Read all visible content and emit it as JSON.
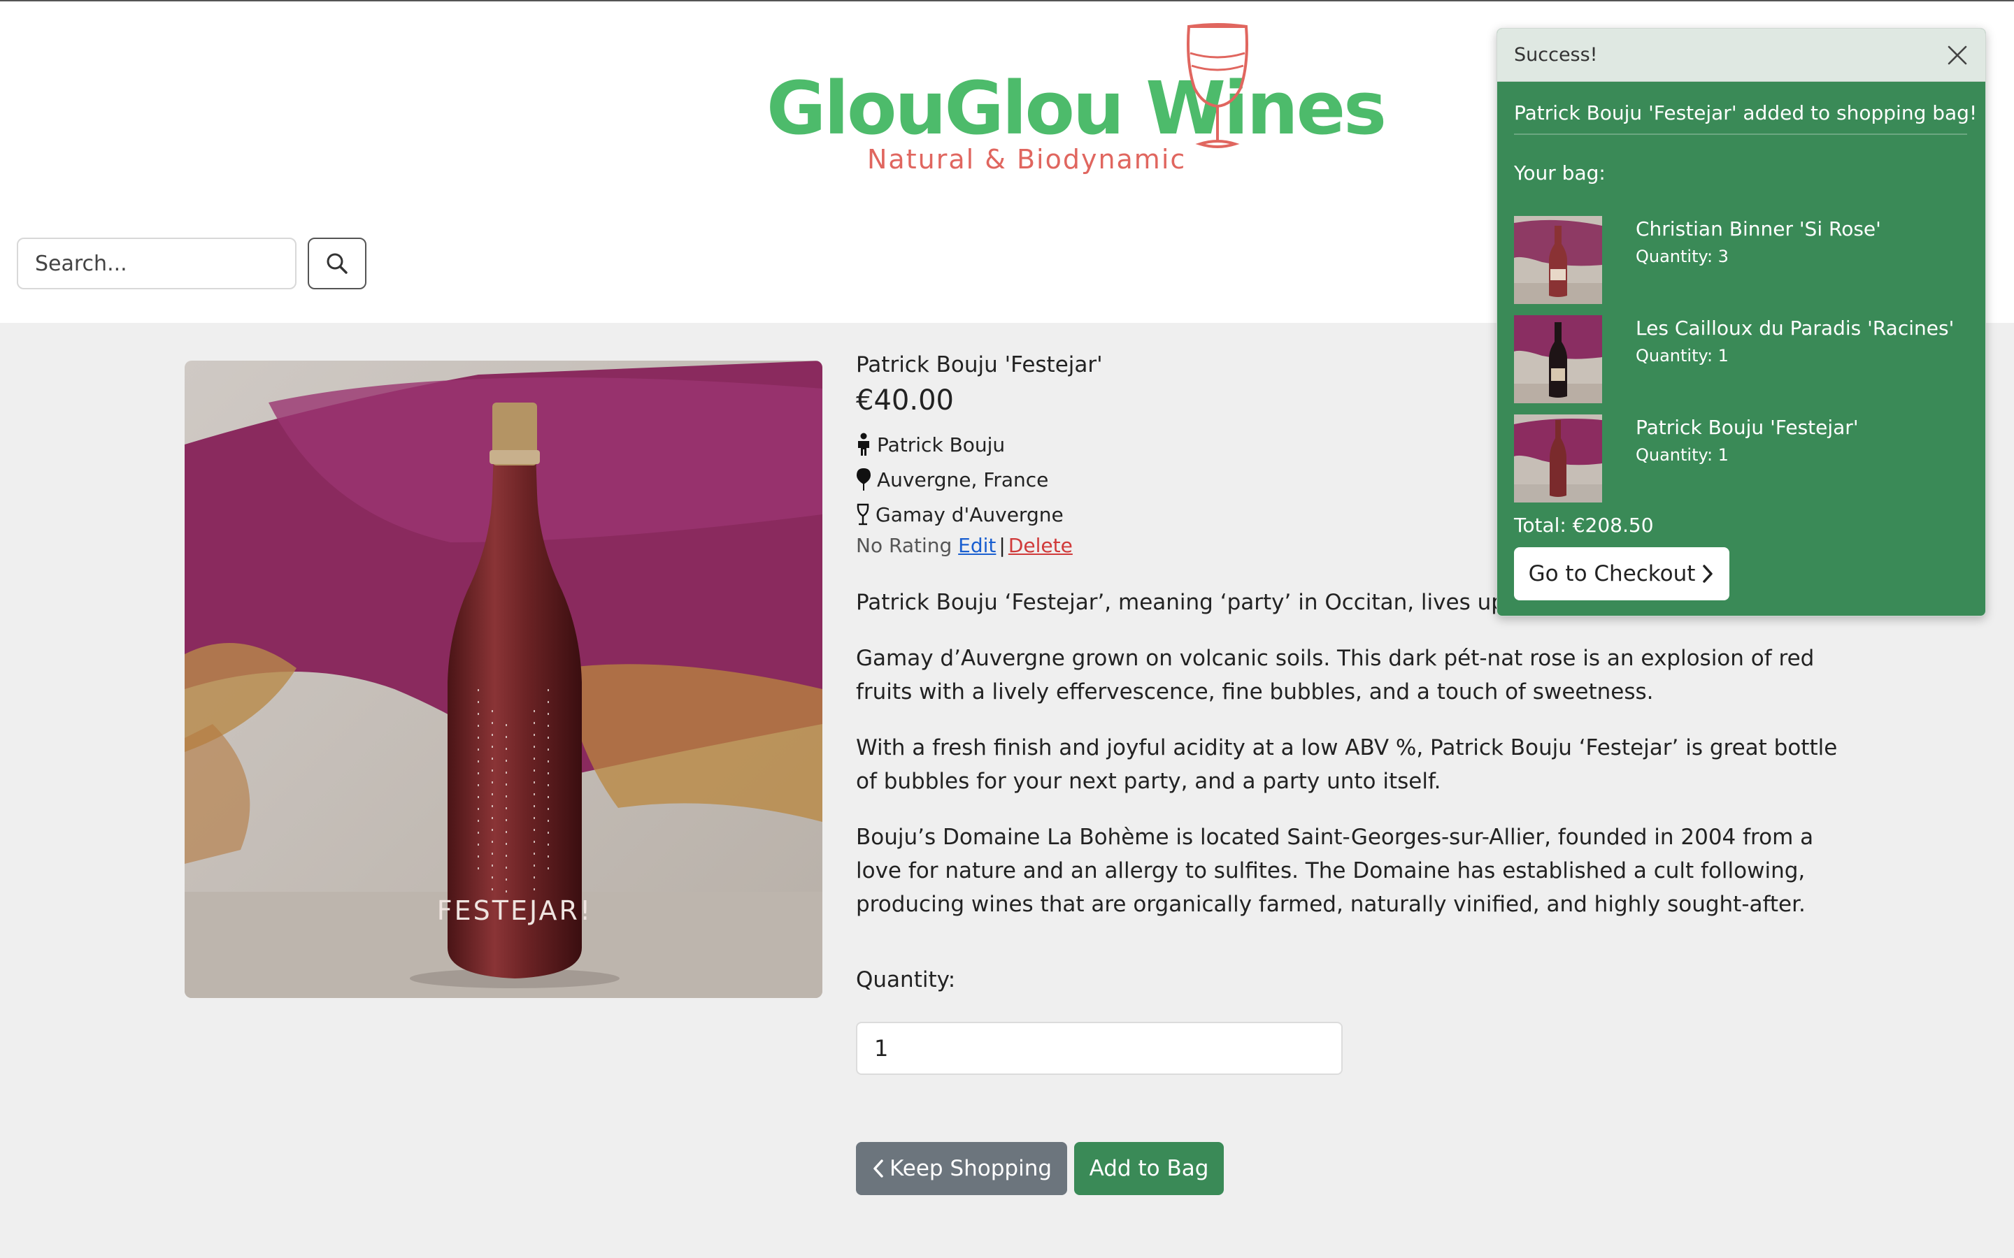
{
  "header": {
    "logo": {
      "title": "GlouGlou Wines",
      "subtitle": "Natural & Biodynamic"
    },
    "search": {
      "placeholder": "Search..."
    }
  },
  "product": {
    "name": "Patrick Bouju 'Festejar'",
    "price": "€40.00",
    "producer": "Patrick Bouju",
    "region": "Auvergne, France",
    "grape": "Gamay d'Auvergne",
    "rating": "No Rating",
    "edit_label": "Edit",
    "delete_label": "Delete",
    "bottle_label": "FESTEJAR!",
    "description": [
      "Patrick Bouju ‘Festejar’, meaning ‘party’ in Occitan, lives up to",
      "Gamay d’Auvergne grown on volcanic soils. This dark pét-nat rose is an explosion of red fruits with a lively effervescence, fine bubbles, and a touch of sweetness.",
      "With a fresh finish and joyful acidity at a low ABV %, Patrick Bouju ‘Festejar’ is great bottle of bubbles for your next party, and a party unto itself.",
      "Bouju’s Domaine La Bohème is located Saint-Georges-sur-Allier, founded in 2004 from a love for nature and an allergy to sulfites. The Domaine has established a cult following, producing wines that are organically farmed, naturally vinified, and highly sought-after."
    ],
    "quantity_label": "Quantity:",
    "quantity_value": "1",
    "keep_shopping_label": "Keep Shopping",
    "add_to_bag_label": "Add to Bag"
  },
  "toast": {
    "title": "Success!",
    "message": "Patrick Bouju 'Festejar' added to shopping bag!",
    "bag_label": "Your bag:",
    "items": [
      {
        "name": "Christian Binner 'Si Rose'",
        "quantity": "Quantity: 3"
      },
      {
        "name": "Les Cailloux du Paradis 'Racines'",
        "quantity": "Quantity: 1"
      },
      {
        "name": "Patrick Bouju 'Festejar'",
        "quantity": "Quantity: 1"
      }
    ],
    "total": "Total: €208.50",
    "checkout_label": "Go to Checkout"
  },
  "colors": {
    "brand_green": "#4dbb6b",
    "brand_red": "#e0665f",
    "toast_green": "#3a8a57",
    "button_gray": "#6c757d",
    "link_blue": "#1a5fd0",
    "link_red": "#d03a3a"
  },
  "icons": {
    "search": "search-icon",
    "producer": "person-icon",
    "region": "map-pin-icon",
    "grape": "wine-glass-icon",
    "back": "chevron-left-icon",
    "forward": "chevron-right-icon",
    "close": "close-icon"
  }
}
